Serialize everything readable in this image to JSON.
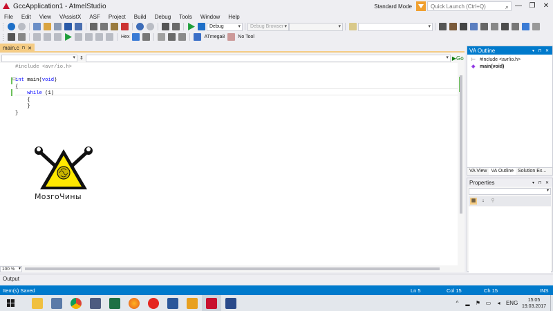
{
  "window": {
    "title": "GccApplication1 - AtmelStudio",
    "mode": "Standard Mode",
    "quick_launch_placeholder": "Quick Launch (Ctrl+Q)",
    "minimize": "—",
    "restore": "❐",
    "close": "✕"
  },
  "menu": [
    "File",
    "Edit",
    "View",
    "VAssistX",
    "ASF",
    "Project",
    "Build",
    "Debug",
    "Tools",
    "Window",
    "Help"
  ],
  "toolbar": {
    "config": "Debug",
    "debug_browser": "Debug Browser",
    "hex_label": "Hex",
    "device": "ATmega8",
    "tool": "No Tool"
  },
  "editor": {
    "tab_label": "main.c",
    "tab_close": "✕",
    "go_label": "Go",
    "zoom": "100 %",
    "lines": [
      {
        "indent": "",
        "parts": [
          {
            "t": "pp",
            "v": "#include <avr/io.h>"
          }
        ]
      },
      {
        "indent": "",
        "parts": []
      },
      {
        "indent": "",
        "parts": [
          {
            "t": "kw",
            "v": "int"
          },
          {
            "t": "",
            "v": " main("
          },
          {
            "t": "kw",
            "v": "void"
          },
          {
            "t": "",
            "v": ")"
          }
        ]
      },
      {
        "indent": "",
        "parts": [
          {
            "t": "",
            "v": "{"
          }
        ]
      },
      {
        "indent": "    ",
        "parts": [
          {
            "t": "kw",
            "v": "while"
          },
          {
            "t": "",
            "v": " (1)"
          }
        ]
      },
      {
        "indent": "    ",
        "parts": [
          {
            "t": "",
            "v": "{"
          }
        ]
      },
      {
        "indent": "    ",
        "parts": [
          {
            "t": "",
            "v": "}"
          }
        ]
      },
      {
        "indent": "",
        "parts": [
          {
            "t": "",
            "v": "}"
          }
        ]
      }
    ]
  },
  "logo": {
    "text": "МозгоЧины"
  },
  "va_outline": {
    "title": "VA Outline",
    "items": [
      {
        "icon": "include",
        "label": "#include <avr/io.h>",
        "bold": false
      },
      {
        "icon": "function",
        "label": "main(void)",
        "bold": true
      }
    ],
    "tabs": [
      "VA View",
      "VA Outline",
      "Solution Ex..."
    ]
  },
  "properties": {
    "title": "Properties"
  },
  "output": {
    "label": "Output"
  },
  "status": {
    "message": "Item(s) Saved",
    "ln": "Ln 5",
    "col": "Col 15",
    "ch": "Ch 15",
    "ins": "INS"
  },
  "taskbar": {
    "lang": "ENG",
    "time": "15:05",
    "date": "19.03.2017"
  },
  "colors": {
    "accent": "#007acc",
    "tab_active": "#f5cc84",
    "keyword": "#0000ff",
    "preprocessor": "#808080",
    "change_bar": "#6cc05a",
    "logo_yellow": "#ffe800"
  }
}
